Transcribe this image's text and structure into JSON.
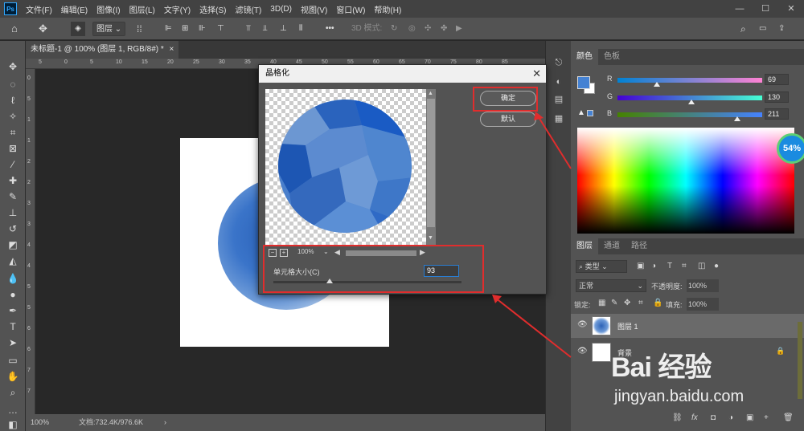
{
  "menu": {
    "app_icon": "Ps",
    "items": [
      "文件(F)",
      "编辑(E)",
      "图像(I)",
      "图层(L)",
      "文字(Y)",
      "选择(S)",
      "滤镜(T)",
      "3D(D)",
      "视图(V)",
      "窗口(W)",
      "帮助(H)"
    ],
    "window_controls": [
      "—",
      "☐",
      "✕"
    ]
  },
  "options": {
    "layer_dropdown": "图层",
    "mode_3d": "3D 模式:"
  },
  "document": {
    "tab_title": "未标题-1 @ 100% (图层 1, RGB/8#) *",
    "tab_close": "×",
    "zoom": "100%",
    "doc_info": "文档:732.4K/976.6K",
    "ruler_top": [
      "5",
      "0",
      "5",
      "10",
      "15",
      "20",
      "25",
      "30",
      "35",
      "40",
      "45",
      "50",
      "55",
      "60",
      "65",
      "70",
      "75",
      "80",
      "85"
    ],
    "ruler_left": [
      "0",
      "5",
      "1",
      "1",
      "2",
      "2",
      "3",
      "3",
      "4",
      "4",
      "5",
      "5",
      "6",
      "6",
      "7",
      "7"
    ]
  },
  "color_panel": {
    "tabs": [
      "颜色",
      "色板"
    ],
    "r_label": "R",
    "r_value": "69",
    "g_label": "G",
    "g_value": "130",
    "b_label": "B",
    "b_value": "211",
    "r_fraction": 0.27,
    "g_fraction": 0.51,
    "b_fraction": 0.83,
    "foreground_color": "#4582d3",
    "badge": "54%"
  },
  "layers_panel": {
    "tabs": [
      "图层",
      "通道",
      "路径"
    ],
    "filter": "类型",
    "blend_mode": "正常",
    "opacity_label": "不透明度:",
    "opacity_value": "100%",
    "lock_label": "锁定:",
    "fill_label": "填充:",
    "fill_value": "100%",
    "layers": [
      {
        "name": "图层 1"
      },
      {
        "name": "背景"
      }
    ],
    "bottom_icons": [
      "⛓",
      "fx",
      "◘",
      "◑",
      "▣",
      "+",
      "🗑"
    ]
  },
  "dialog": {
    "title": "晶格化",
    "close": "✕",
    "ok_label": "确定",
    "default_label": "默认",
    "zoom_value": "100%",
    "zoom_minus": "−",
    "zoom_plus": "+",
    "cell_size_label": "单元格大小(C)",
    "cell_size_value": "93",
    "cell_size_fraction": 0.3
  },
  "watermark": {
    "logo": "Bai 经验",
    "url": "jingyan.baidu.com"
  }
}
